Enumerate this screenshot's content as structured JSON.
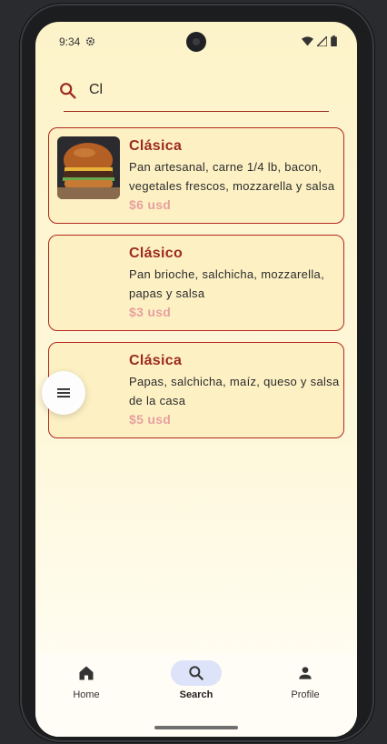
{
  "status": {
    "time": "9:34",
    "icons": [
      "settings-icon",
      "wifi-icon",
      "signal-icon",
      "battery-icon"
    ]
  },
  "search": {
    "value": "Cl",
    "icon": "search-icon"
  },
  "results": [
    {
      "name": "Clásica",
      "description": "Pan artesanal, carne 1/4 lb, bacon, vegetales frescos, mozzarella y salsa",
      "price": "$6 usd",
      "has_image": true
    },
    {
      "name": "Clásico",
      "description": "Pan brioche, salchicha, mozzarella, papas y salsa",
      "price": "$3 usd",
      "has_image": false
    },
    {
      "name": "Clásica",
      "description": "Papas, salchicha, maíz, queso y salsa de la casa",
      "price": "$5 usd",
      "has_image": false
    }
  ],
  "fab": {
    "icon": "menu-icon"
  },
  "bottom_nav": {
    "items": [
      {
        "label": "Home",
        "icon": "home-icon",
        "active": false
      },
      {
        "label": "Search",
        "icon": "search-icon",
        "active": true
      },
      {
        "label": "Profile",
        "icon": "person-icon",
        "active": false
      }
    ]
  },
  "colors": {
    "background": "#fdf3c9",
    "accent": "#9c2a1d",
    "card_border": "#b3261e",
    "price": "#e7a0a0",
    "nav_active": "#dde3f8"
  }
}
